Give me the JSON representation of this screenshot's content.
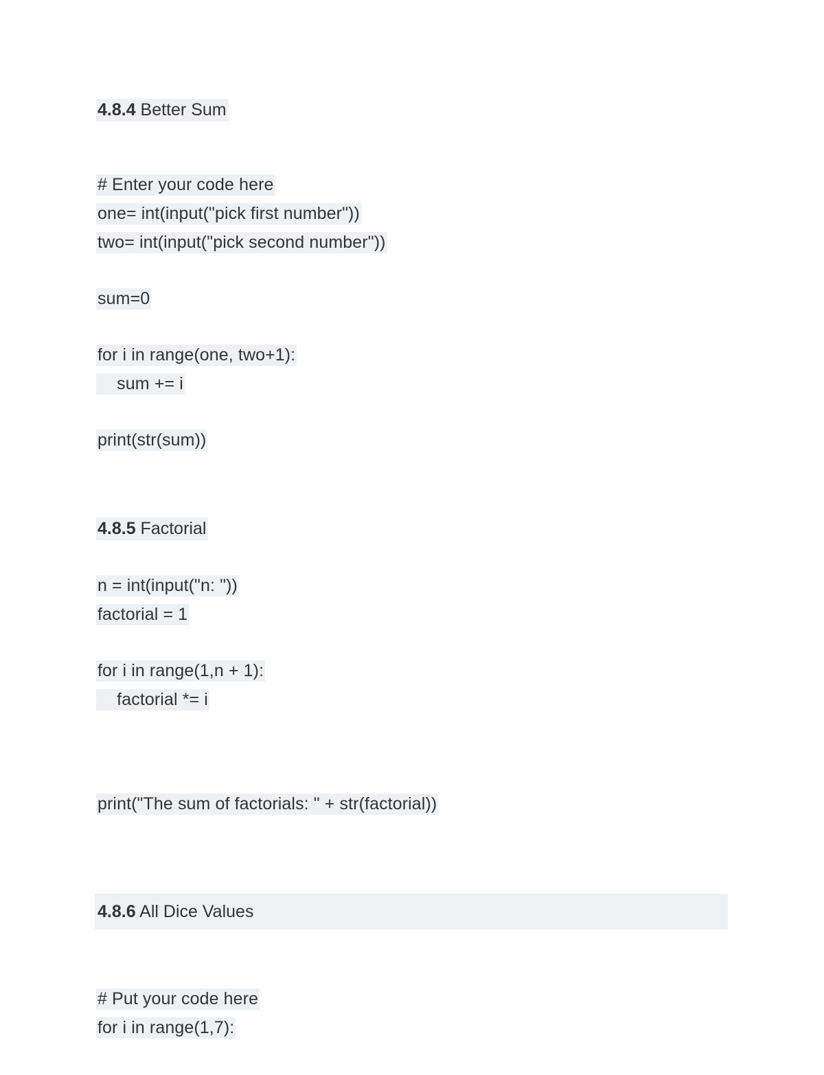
{
  "document": {
    "sections": [
      {
        "heading": {
          "number": "4.8.4",
          "title": " Better Sum"
        },
        "code_lines": [
          "# Enter your code here",
          "one= int(input(\"pick first number\"))",
          "two= int(input(\"pick second number\"))",
          "sum=0",
          "for i in range(one, two+1):",
          "    sum += i",
          "print(str(sum))"
        ]
      },
      {
        "heading": {
          "number": "4.8.5",
          "title": " Factorial"
        },
        "code_lines": [
          "n = int(input(\"n: \"))",
          "factorial = 1",
          "for i in range(1,n + 1):",
          "    factorial *= i",
          "print(\"The sum of factorials: \" + str(factorial))"
        ]
      },
      {
        "heading": {
          "number": "4.8.6",
          "title": " All Dice Values"
        },
        "code_lines": [
          "# Put your code here",
          "for i in range(1,7):"
        ]
      }
    ]
  },
  "style": {
    "highlight_color": "#edf1f4",
    "text_color": "#333333",
    "page_background": "#ffffff"
  }
}
